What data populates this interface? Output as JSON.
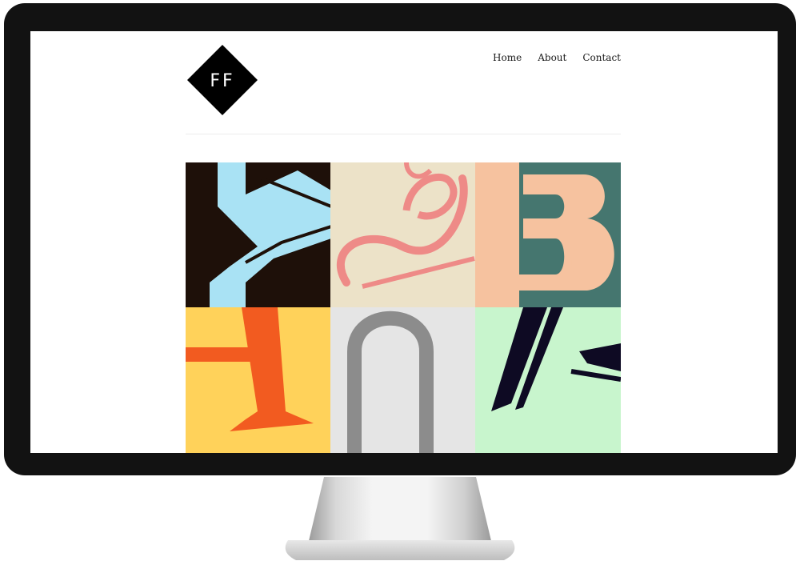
{
  "logo": {
    "text": "FF"
  },
  "nav": {
    "items": [
      "Home",
      "About",
      "Contact"
    ]
  },
  "gallery": {
    "tiles": [
      {
        "glyph": "Y",
        "background": "#1e1009",
        "color": "#a9e2f4"
      },
      {
        "glyph": "g",
        "background": "#ece2c8",
        "color": "#ee8a87"
      },
      {
        "glyph": "3",
        "background": "#f6c29f",
        "color": "#45766f"
      },
      {
        "glyph": "A",
        "background": "#ffd25a",
        "color": "#f25b20"
      },
      {
        "glyph": "n",
        "background": "#e5e5e5",
        "color": "#8c8c8c"
      },
      {
        "glyph": "k",
        "background": "#c8f5cd",
        "color": "#0e0a23"
      }
    ]
  }
}
